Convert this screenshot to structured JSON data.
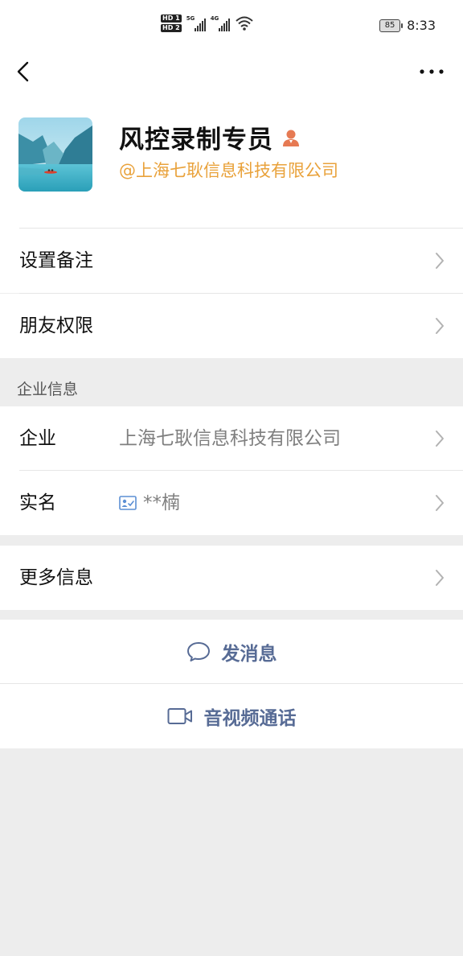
{
  "status_bar": {
    "hd1": "HD 1",
    "hd2": "HD 2",
    "net1": "5G",
    "net2": "4G",
    "battery": "85",
    "time": "8:33"
  },
  "profile": {
    "name": "风控录制专员",
    "company_tag": "@上海七耿信息科技有限公司"
  },
  "rows": {
    "remark": "设置备注",
    "permission": "朋友权限"
  },
  "enterprise": {
    "section_title": "企业信息",
    "company_label": "企业",
    "company_value": "上海七耿信息科技有限公司",
    "realname_label": "实名",
    "realname_value": "**楠"
  },
  "more_info": "更多信息",
  "actions": {
    "message": "发消息",
    "call": "音视频通话"
  },
  "colors": {
    "accent_link": "#576b95",
    "company_orange": "#e9a23b",
    "background": "#ededed"
  }
}
